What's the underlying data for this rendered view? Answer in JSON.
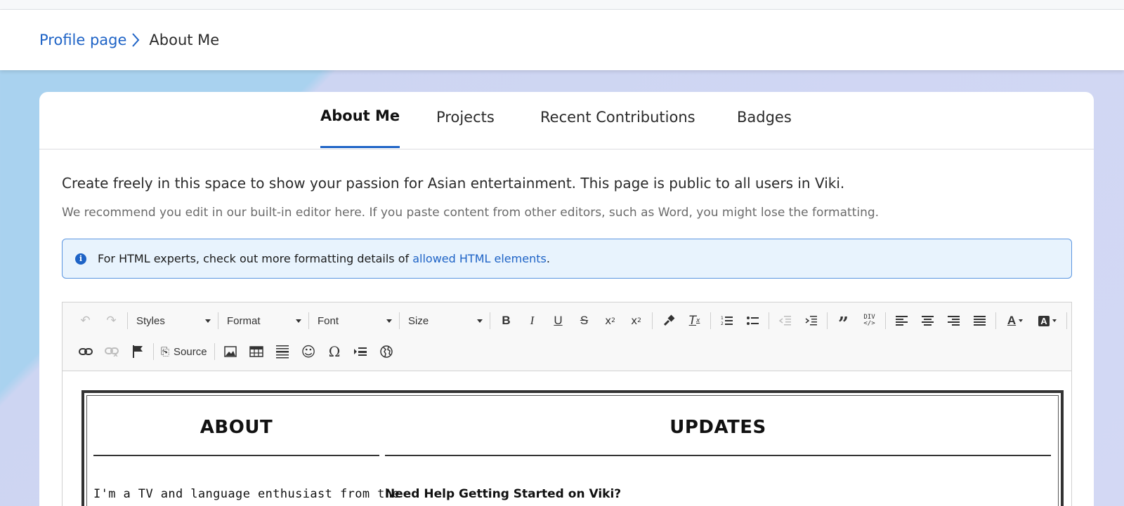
{
  "breadcrumb": {
    "parent": "Profile page",
    "current": "About Me"
  },
  "tabs": [
    {
      "label": "About Me",
      "active": true
    },
    {
      "label": "Projects",
      "active": false
    },
    {
      "label": "Recent Contributions",
      "active": false
    },
    {
      "label": "Badges",
      "active": false
    }
  ],
  "intro": {
    "headline": "Create freely in this space to show your passion for Asian entertainment. This page is public to all users in Viki.",
    "subtext": "We recommend you edit in our built-in editor here. If you paste content from other editors, such as Word, you might lose the formatting."
  },
  "info": {
    "text": "For HTML experts, check out more formatting details of ",
    "link": "allowed HTML elements",
    "suffix": "."
  },
  "toolbar": {
    "styles": "Styles",
    "format": "Format",
    "font": "Font",
    "size": "Size",
    "source": "Source"
  },
  "document": {
    "about_heading": "ABOUT",
    "updates_heading": "UPDATES",
    "about_text": "I'm a TV and language enthusiast from the",
    "updates_text": "Need Help Getting Started on Viki?"
  },
  "colors": {
    "accent": "#1e63c6",
    "info_bg": "#e8f3fd"
  }
}
